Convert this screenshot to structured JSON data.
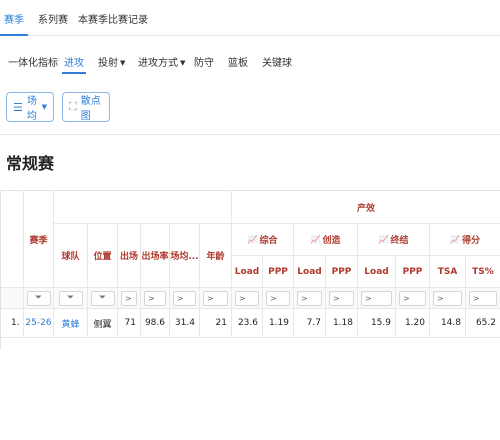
{
  "top_tabs": [
    {
      "label": "赛季",
      "active": true
    },
    {
      "label": "系列赛",
      "active": false
    },
    {
      "label": "本赛季比赛记录",
      "active": false
    }
  ],
  "sub_tabs": [
    {
      "label": "一体化指标"
    },
    {
      "label": "进攻",
      "active": true
    },
    {
      "label": "投射",
      "dropdown": true
    },
    {
      "label": "进攻方式",
      "dropdown": true
    },
    {
      "label": "防守"
    },
    {
      "label": "篮板"
    },
    {
      "label": "关键球"
    }
  ],
  "toolbar": {
    "per_game_label": "场均",
    "scatter_label": "散点图"
  },
  "section_title": "常规赛",
  "table": {
    "fixed_headers": {
      "season": "赛季",
      "team": "球队",
      "position": "位置",
      "games": "出场",
      "games_pct": "出场率",
      "minutes": "场均...",
      "age": "年龄"
    },
    "super_header": "产效",
    "groups": [
      {
        "label": "综合",
        "cols": [
          "Load",
          "PPP"
        ]
      },
      {
        "label": "创造",
        "cols": [
          "Load",
          "PPP"
        ]
      },
      {
        "label": "终结",
        "cols": [
          "Load",
          "PPP"
        ]
      },
      {
        "label": "得分",
        "cols": [
          "TSA",
          "TS%"
        ]
      }
    ],
    "filter_placeholder": ">",
    "rows": [
      {
        "index": "1.",
        "season": "25-26",
        "team": "黄蜂",
        "position": "侧翼",
        "games": "71",
        "games_pct": "98.6",
        "minutes": "31.4",
        "age": "21",
        "values": [
          "23.6",
          "1.19",
          "7.7",
          "1.18",
          "15.9",
          "1.20",
          "14.8",
          "65.2"
        ]
      }
    ]
  },
  "colors": {
    "accent": "#2f7fd8",
    "header_red": "#b03a2e"
  }
}
